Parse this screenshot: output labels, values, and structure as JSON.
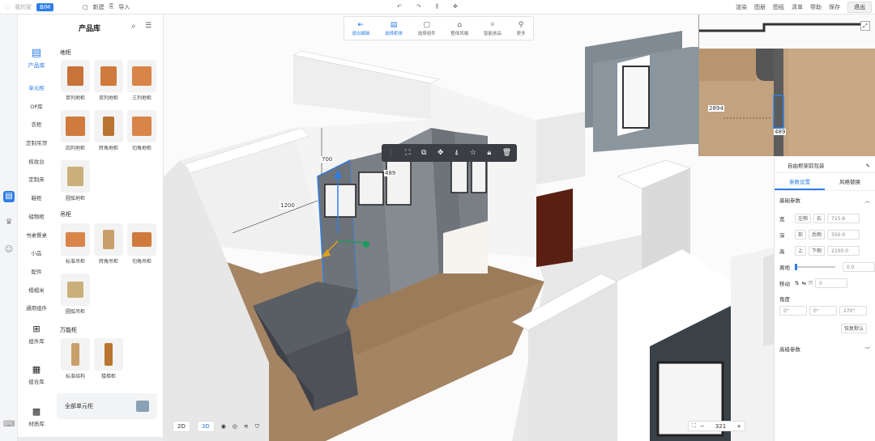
{
  "topbar": {
    "app": "我的家",
    "badge": "BIM",
    "new": "新建",
    "import": "导入",
    "right": [
      "渲染",
      "图册",
      "图纸",
      "清单",
      "帮助",
      "保存"
    ],
    "exit": "退出"
  },
  "panel": {
    "title": "产品库",
    "main_category": "产品库",
    "categories": [
      "单元柜",
      "OP库",
      "衣柜",
      "定制吊顶",
      "梳妆台",
      "定制床",
      "鞋柜",
      "储物柜",
      "书桌餐桌",
      "小品",
      "配件",
      "榻榻米",
      "通用组件"
    ],
    "big": [
      "组件库",
      "组合库",
      "材质库"
    ],
    "sections": {
      "floor": "地柜",
      "hanging": "吊柜",
      "universal": "万能柜"
    },
    "floor_items": [
      "单列地柜",
      "双列地柜",
      "三列地柜",
      "四列地柜",
      "转角地柜",
      "切角地柜",
      "圆弧地柜"
    ],
    "hanging_items": [
      "标准吊柜",
      "转角吊柜",
      "切角吊柜",
      "圆弧吊柜"
    ],
    "universal_items": [
      "标准结构",
      "楼梯柜"
    ],
    "all_units": "全部单元柜"
  },
  "toolbar": {
    "items": [
      "退出编辑",
      "选择柜体",
      "选择组件",
      "整体风格",
      "智能放品",
      "更多"
    ]
  },
  "dims": {
    "height": "700",
    "depth": "489",
    "width": "1200"
  },
  "minimap": {
    "d1": "2894",
    "d2": "489"
  },
  "props": {
    "header": "自由柜架前包装",
    "tab1": "参数设置",
    "tab2": "风格替换",
    "basic": "基础参数",
    "w_label": "宽",
    "w_opts": [
      "左侧",
      "右"
    ],
    "w_val": "715.6",
    "d_label": "深",
    "d_opts": [
      "前",
      "后侧"
    ],
    "d_val": "350.0",
    "h_label": "高",
    "h_opts": [
      "上",
      "下侧"
    ],
    "h_val": "2100.0",
    "lift_label": "离地",
    "lift_val": "0.0",
    "move_label": "移动",
    "move_val": "0",
    "angle_label": "角度",
    "angles": [
      "0°",
      "0°",
      "270°"
    ],
    "reset": "恢复默认",
    "advanced": "高级参数"
  },
  "bottom": {
    "v2d": "2D",
    "v3d": "3D",
    "zoom": "321"
  }
}
